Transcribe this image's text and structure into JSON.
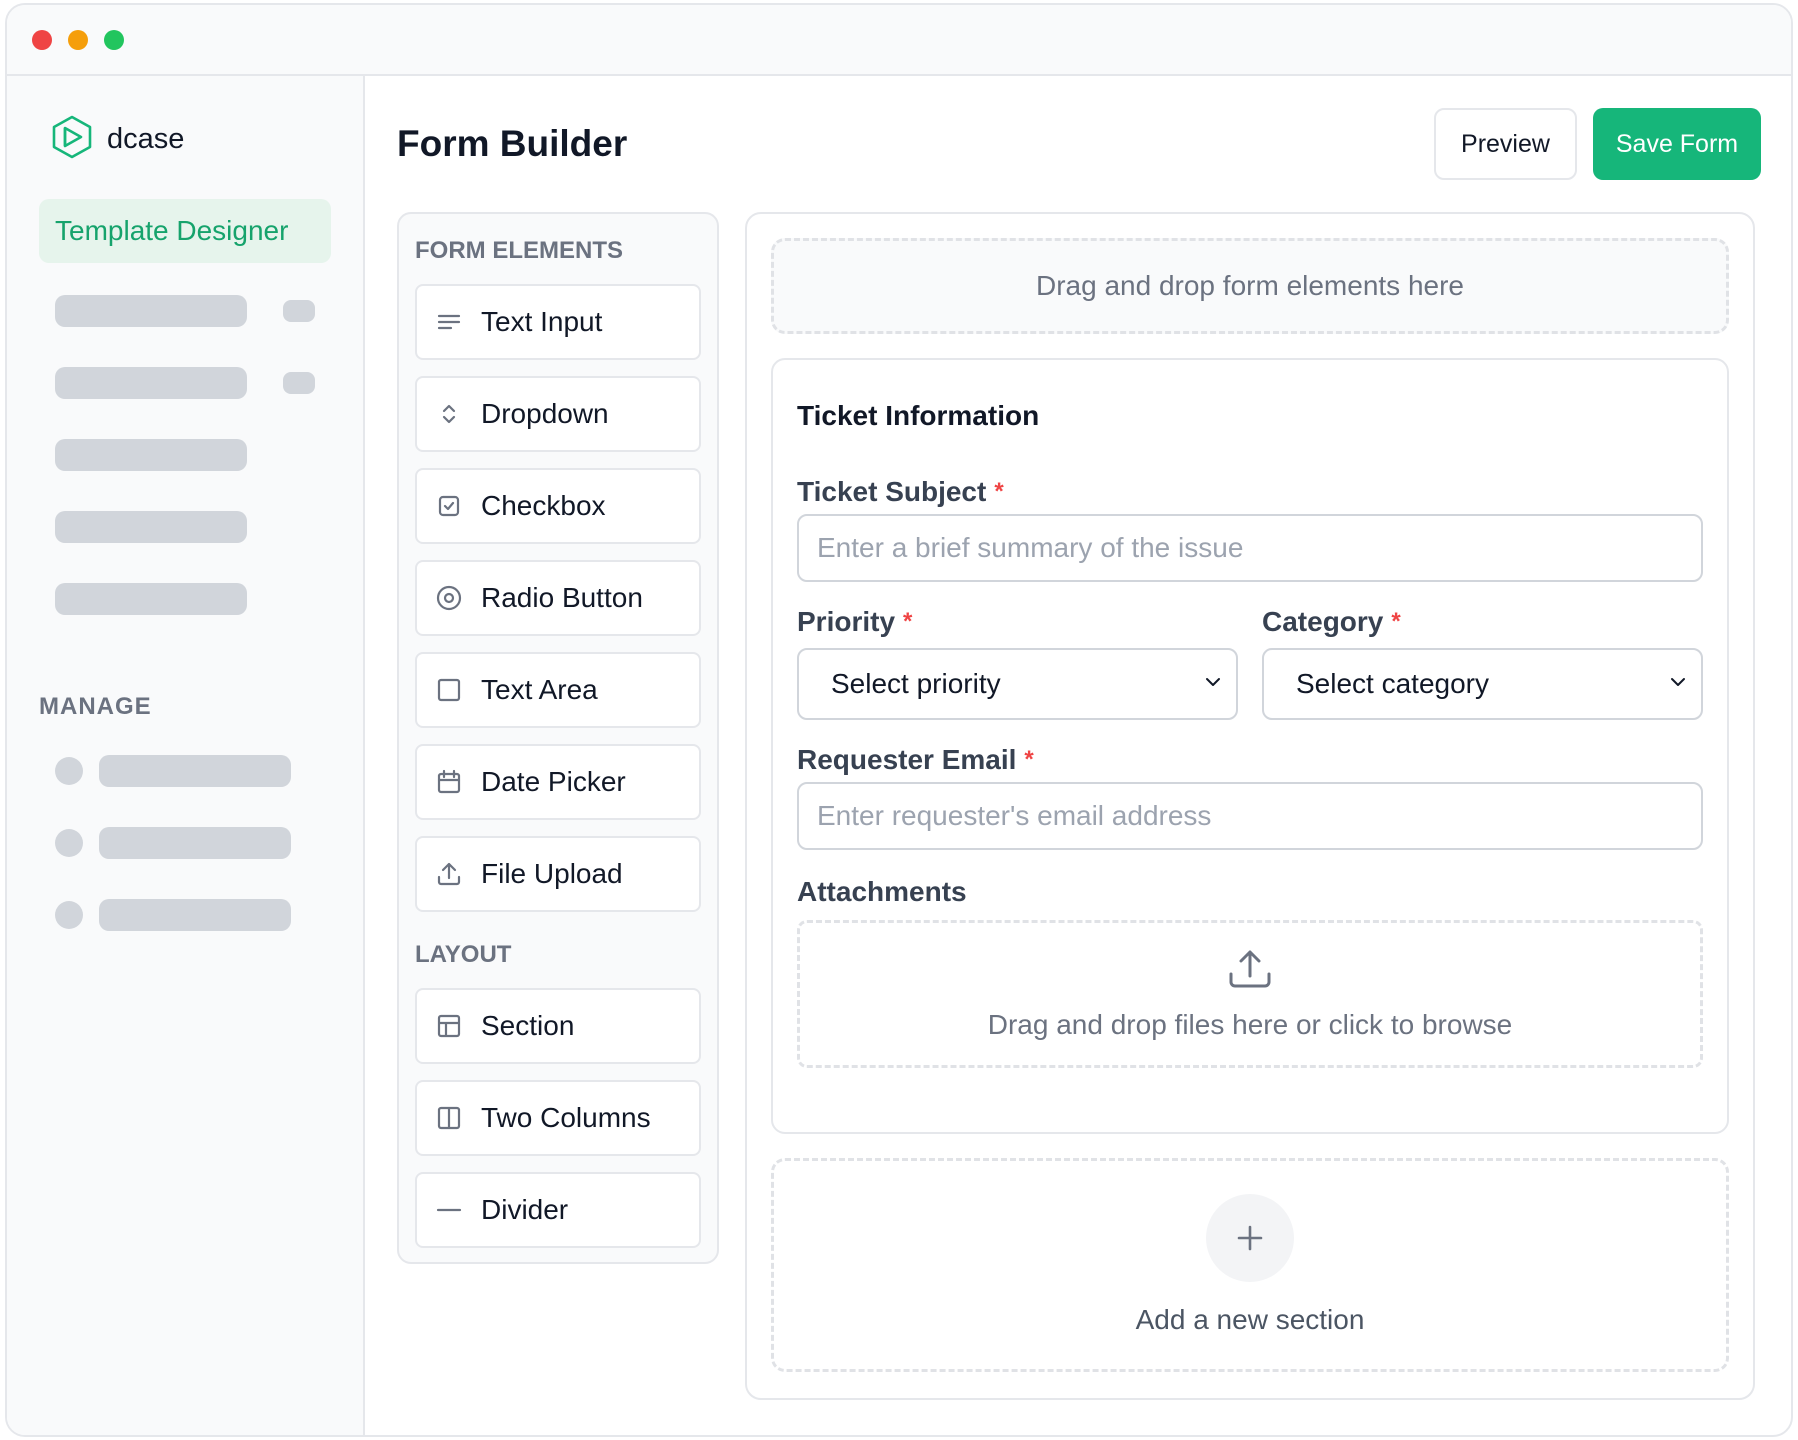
{
  "window": {
    "traffic_lights": [
      "#ef4444",
      "#f59e0b",
      "#22c55e"
    ]
  },
  "sidebar": {
    "brand": "dcase",
    "active_item": "Template Designer",
    "manage_heading": "MANAGE"
  },
  "header": {
    "title": "Form Builder",
    "preview_label": "Preview",
    "save_label": "Save Form"
  },
  "palette": {
    "form_elements_heading": "FORM ELEMENTS",
    "form_elements": [
      {
        "label": "Text Input",
        "icon": "lines-icon"
      },
      {
        "label": "Dropdown",
        "icon": "chevron-up-down-icon"
      },
      {
        "label": "Checkbox",
        "icon": "checkbox-icon"
      },
      {
        "label": "Radio Button",
        "icon": "radio-icon"
      },
      {
        "label": "Text Area",
        "icon": "square-icon"
      },
      {
        "label": "Date Picker",
        "icon": "calendar-icon"
      },
      {
        "label": "File Upload",
        "icon": "upload-icon"
      }
    ],
    "layout_heading": "LAYOUT",
    "layout_elements": [
      {
        "label": "Section",
        "icon": "section-layout-icon"
      },
      {
        "label": "Two Columns",
        "icon": "two-columns-icon"
      },
      {
        "label": "Divider",
        "icon": "divider-icon"
      }
    ]
  },
  "canvas": {
    "dropzone_text": "Drag and drop form elements here",
    "section": {
      "title": "Ticket Information",
      "subject": {
        "label": "Ticket Subject",
        "required": "*",
        "placeholder": "Enter a brief summary of the issue"
      },
      "priority": {
        "label": "Priority",
        "required": "*",
        "value": "Select priority"
      },
      "category": {
        "label": "Category",
        "required": "*",
        "value": "Select category"
      },
      "email": {
        "label": "Requester Email",
        "required": "*",
        "placeholder": "Enter requester's email address"
      },
      "attachments": {
        "label": "Attachments",
        "text": "Drag and drop files here or click to browse"
      }
    },
    "add_section_text": "Add a new section"
  },
  "colors": {
    "accent": "#16b67a",
    "accent_text": "#16a36c",
    "active_bg": "#e6f4ec",
    "required": "#ef4444"
  }
}
